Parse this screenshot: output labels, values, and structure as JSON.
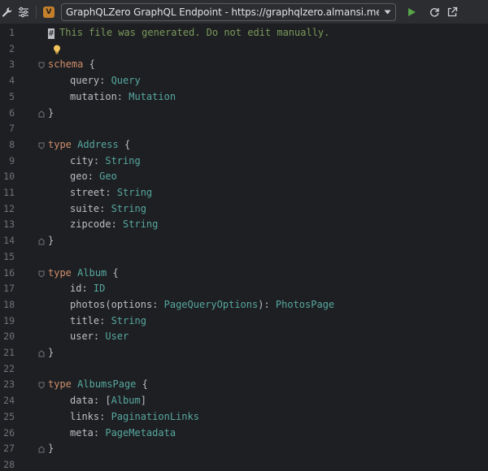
{
  "toolbar": {
    "endpoint_badge": "V",
    "endpoint_text": "GraphQLZero GraphQL Endpoint - https://graphqlzero.almansi.me/api",
    "icons": [
      "wrench-icon",
      "settings-sliders-icon",
      "dropdown-arrow-icon",
      "run-icon",
      "refresh-icon",
      "open-external-icon"
    ]
  },
  "editor": {
    "lines": [
      {
        "n": "1",
        "comment": "This file was generated. Do not edit manually."
      },
      {
        "n": "2"
      },
      {
        "n": "3",
        "kw": "schema",
        "rest": " {"
      },
      {
        "n": "4",
        "field": "query",
        "type": "Query"
      },
      {
        "n": "5",
        "field": "mutation",
        "type": "Mutation"
      },
      {
        "n": "6",
        "close": "}"
      },
      {
        "n": "7"
      },
      {
        "n": "8",
        "kw": "type",
        "name": "Address",
        "rest": " {"
      },
      {
        "n": "9",
        "field": "city",
        "type": "String"
      },
      {
        "n": "10",
        "field": "geo",
        "type": "Geo"
      },
      {
        "n": "11",
        "field": "street",
        "type": "String"
      },
      {
        "n": "12",
        "field": "suite",
        "type": "String"
      },
      {
        "n": "13",
        "field": "zipcode",
        "type": "String"
      },
      {
        "n": "14",
        "close": "}"
      },
      {
        "n": "15"
      },
      {
        "n": "16",
        "kw": "type",
        "name": "Album",
        "rest": " {"
      },
      {
        "n": "17",
        "field": "id",
        "type": "ID"
      },
      {
        "n": "18",
        "field": "photos",
        "arg": "options",
        "argtype": "PageQueryOptions",
        "type": "PhotosPage"
      },
      {
        "n": "19",
        "field": "title",
        "type": "String"
      },
      {
        "n": "20",
        "field": "user",
        "type": "User"
      },
      {
        "n": "21",
        "close": "}"
      },
      {
        "n": "22"
      },
      {
        "n": "23",
        "kw": "type",
        "name": "AlbumsPage",
        "rest": " {"
      },
      {
        "n": "24",
        "field": "data",
        "type": "[Album]"
      },
      {
        "n": "25",
        "field": "links",
        "type": "PaginationLinks"
      },
      {
        "n": "26",
        "field": "meta",
        "type": "PageMetadata"
      },
      {
        "n": "27",
        "close": "}"
      },
      {
        "n": "28"
      }
    ]
  }
}
